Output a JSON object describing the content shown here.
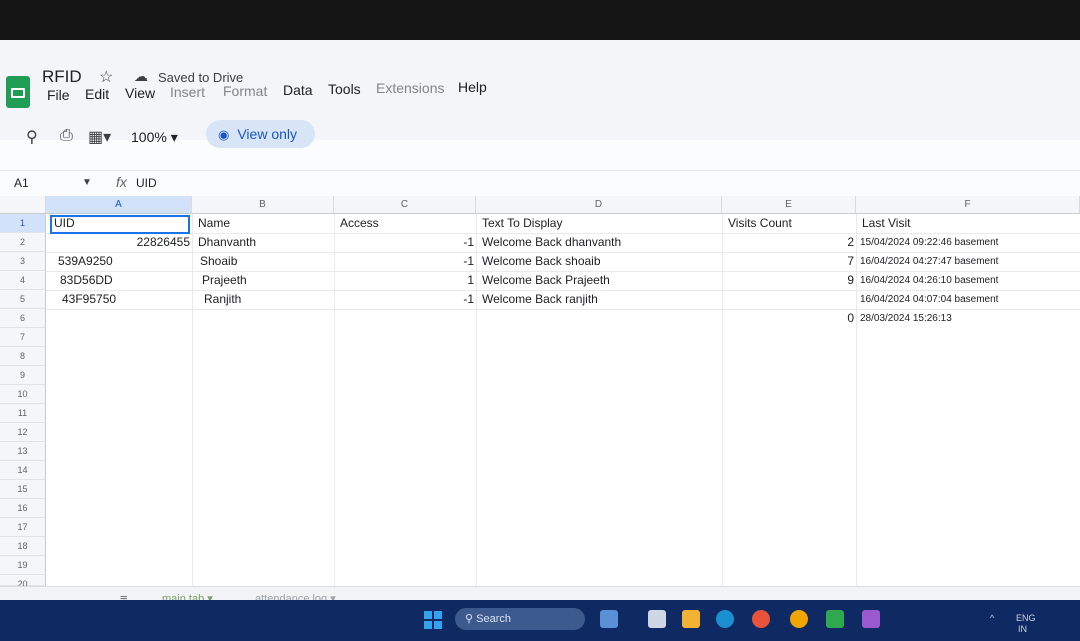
{
  "app": {
    "doc_title": "RFID",
    "saved_status": "Saved to Drive",
    "menu": [
      "File",
      "Edit",
      "View",
      "Insert",
      "Format",
      "Data",
      "Tools",
      "Extensions",
      "Help"
    ],
    "zoom": "100%",
    "view_only_label": "View only",
    "icons": {
      "logo": "google-sheets-logo",
      "star": "star-icon",
      "cloud": "cloud-saved-icon",
      "search": "search-icon",
      "print": "print-icon",
      "format": "table-format-icon",
      "eye": "eye-icon"
    }
  },
  "formula": {
    "name_box": "A1",
    "fx_symbol": "fx",
    "content": "UID"
  },
  "grid": {
    "columns": [
      "A",
      "B",
      "C",
      "D",
      "E",
      "F"
    ],
    "row_numbers": [
      "1",
      "2",
      "3",
      "4",
      "5",
      "6",
      "7",
      "8",
      "9",
      "10",
      "11",
      "12",
      "13",
      "14",
      "15",
      "16",
      "17",
      "18",
      "19",
      "20"
    ],
    "rows": [
      {
        "a": "UID",
        "b": "Name",
        "c": "Access",
        "d_num": "",
        "d_text": "Text To Display",
        "e": "Visits Count",
        "f_num": "",
        "f_text": "Last Visit"
      },
      {
        "a": "22826455",
        "b": "Dhanvanth",
        "c": "",
        "d_num": "-1",
        "d_text": "Welcome Back dhanvanth",
        "e": "",
        "f_num": "2",
        "f_text": "15/04/2024 09:22:46 basement"
      },
      {
        "a": "539A9250",
        "b": "Shoaib",
        "c": "",
        "d_num": "-1",
        "d_text": "Welcome Back shoaib",
        "e": "",
        "f_num": "7",
        "f_text": "16/04/2024 04:27:47 basement"
      },
      {
        "a": "83D56DD",
        "b": "Prajeeth",
        "c": "",
        "d_num": "1",
        "d_text": "Welcome Back Prajeeth",
        "e": "",
        "f_num": "9",
        "f_text": "16/04/2024 04:26:10 basement"
      },
      {
        "a": "43F95750",
        "b": "Ranjith",
        "c": "",
        "d_num": "-1",
        "d_text": "Welcome Back ranjith",
        "e": "",
        "f_num": "",
        "f_text": "16/04/2024 04:07:04 basement"
      },
      {
        "a": "",
        "b": "",
        "c": "",
        "d_num": "",
        "d_text": "",
        "e": "",
        "f_num": "0",
        "f_text": "28/03/2024 15:26:13"
      }
    ]
  },
  "sheets": {
    "menu_icon": "all-sheets-icon",
    "tabs": [
      {
        "label": "main tab",
        "active": true
      },
      {
        "label": "attendance log",
        "active": false
      }
    ]
  },
  "taskbar": {
    "search_label": "Search",
    "lang": "ENG",
    "lang_sub": "IN",
    "colors": {
      "bar": "#0f2a63"
    }
  },
  "colors": {
    "accent": "#1a73e8",
    "sheets_green": "#1f9d55"
  }
}
